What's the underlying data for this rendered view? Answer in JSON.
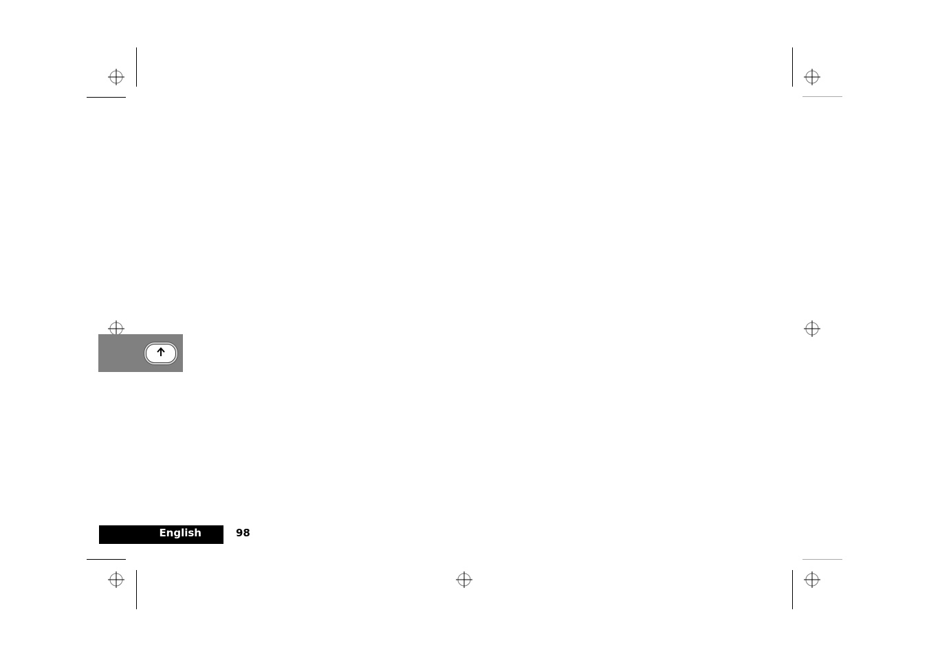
{
  "page": {
    "language_label": "English",
    "page_number": "98"
  },
  "sidebar_key": {
    "icon": "up-arrow-key-icon",
    "background_color": "#808080"
  },
  "registration_marks": {
    "icon": "crosshair-registration-icon"
  }
}
